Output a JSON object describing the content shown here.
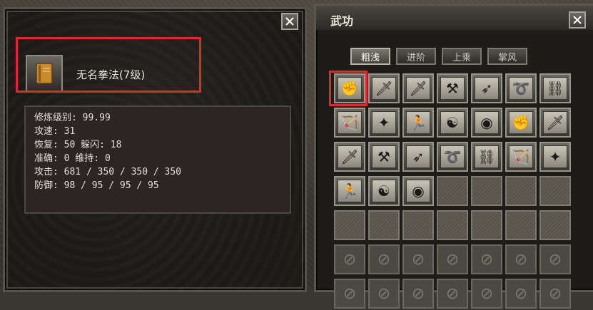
{
  "colors": {
    "highlight": "#e0282d",
    "panel": "#1b1a18",
    "stats_bg": "#2c2525"
  },
  "left_panel": {
    "close_label": "✕",
    "item": {
      "icon": "book-icon",
      "name": "无名拳法(7级)"
    },
    "stats": [
      "修炼级别: 99.99",
      "攻速: 31",
      "恢复: 50 躲闪: 18",
      "准确: 0 维持: 0",
      "攻击: 681 / 350 / 350 / 350",
      "防御: 98 / 95 / 95 / 95"
    ]
  },
  "right_panel": {
    "title": "武功",
    "close_label": "✕",
    "tabs": [
      {
        "label": "粗浅",
        "active": true
      },
      {
        "label": "进阶",
        "active": false
      },
      {
        "label": "上乘",
        "active": false
      },
      {
        "label": "掌风",
        "active": false
      }
    ],
    "slots": [
      {
        "type": "skill",
        "icon": "fist-icon",
        "glyph": "✊"
      },
      {
        "type": "skill",
        "icon": "sword-icon",
        "glyph": "🗡"
      },
      {
        "type": "skill",
        "icon": "sword-icon",
        "glyph": "🗡"
      },
      {
        "type": "skill",
        "icon": "axe-icon",
        "glyph": "⚒"
      },
      {
        "type": "skill",
        "icon": "spear-icon",
        "glyph": "➶"
      },
      {
        "type": "skill",
        "icon": "whip-icon",
        "glyph": "➰"
      },
      {
        "type": "skill",
        "icon": "nunchaku-icon",
        "glyph": "⛓"
      },
      {
        "type": "skill",
        "icon": "bow-icon",
        "glyph": "🏹"
      },
      {
        "type": "skill",
        "icon": "shuriken-icon",
        "glyph": "✦"
      },
      {
        "type": "skill",
        "icon": "kick-icon",
        "glyph": "🏃"
      },
      {
        "type": "skill",
        "icon": "meditate-icon",
        "glyph": "☯"
      },
      {
        "type": "skill",
        "icon": "circle-icon",
        "glyph": "◉"
      },
      {
        "type": "skill",
        "icon": "fist-icon",
        "glyph": "✊"
      },
      {
        "type": "skill",
        "icon": "sword-icon",
        "glyph": "🗡"
      },
      {
        "type": "skill",
        "icon": "sword-icon",
        "glyph": "🗡"
      },
      {
        "type": "skill",
        "icon": "axe-icon",
        "glyph": "⚒"
      },
      {
        "type": "skill",
        "icon": "spear-icon",
        "glyph": "➶"
      },
      {
        "type": "skill",
        "icon": "whip-icon",
        "glyph": "➰"
      },
      {
        "type": "skill",
        "icon": "nunchaku-icon",
        "glyph": "⛓"
      },
      {
        "type": "skill",
        "icon": "bow-icon",
        "glyph": "🏹"
      },
      {
        "type": "skill",
        "icon": "shuriken-icon",
        "glyph": "✦"
      },
      {
        "type": "skill",
        "icon": "kick-icon",
        "glyph": "🏃"
      },
      {
        "type": "skill",
        "icon": "meditate-icon",
        "glyph": "☯"
      },
      {
        "type": "skill",
        "icon": "circle-icon",
        "glyph": "◉"
      },
      {
        "type": "empty"
      },
      {
        "type": "empty"
      },
      {
        "type": "empty"
      },
      {
        "type": "empty"
      },
      {
        "type": "empty"
      },
      {
        "type": "empty"
      },
      {
        "type": "empty"
      },
      {
        "type": "empty"
      },
      {
        "type": "empty"
      },
      {
        "type": "empty"
      },
      {
        "type": "empty"
      },
      {
        "type": "locked"
      },
      {
        "type": "locked"
      },
      {
        "type": "locked"
      },
      {
        "type": "locked"
      },
      {
        "type": "locked"
      },
      {
        "type": "locked"
      },
      {
        "type": "locked"
      },
      {
        "type": "locked"
      },
      {
        "type": "locked"
      },
      {
        "type": "locked"
      },
      {
        "type": "locked"
      },
      {
        "type": "locked"
      },
      {
        "type": "locked"
      },
      {
        "type": "locked"
      }
    ]
  }
}
